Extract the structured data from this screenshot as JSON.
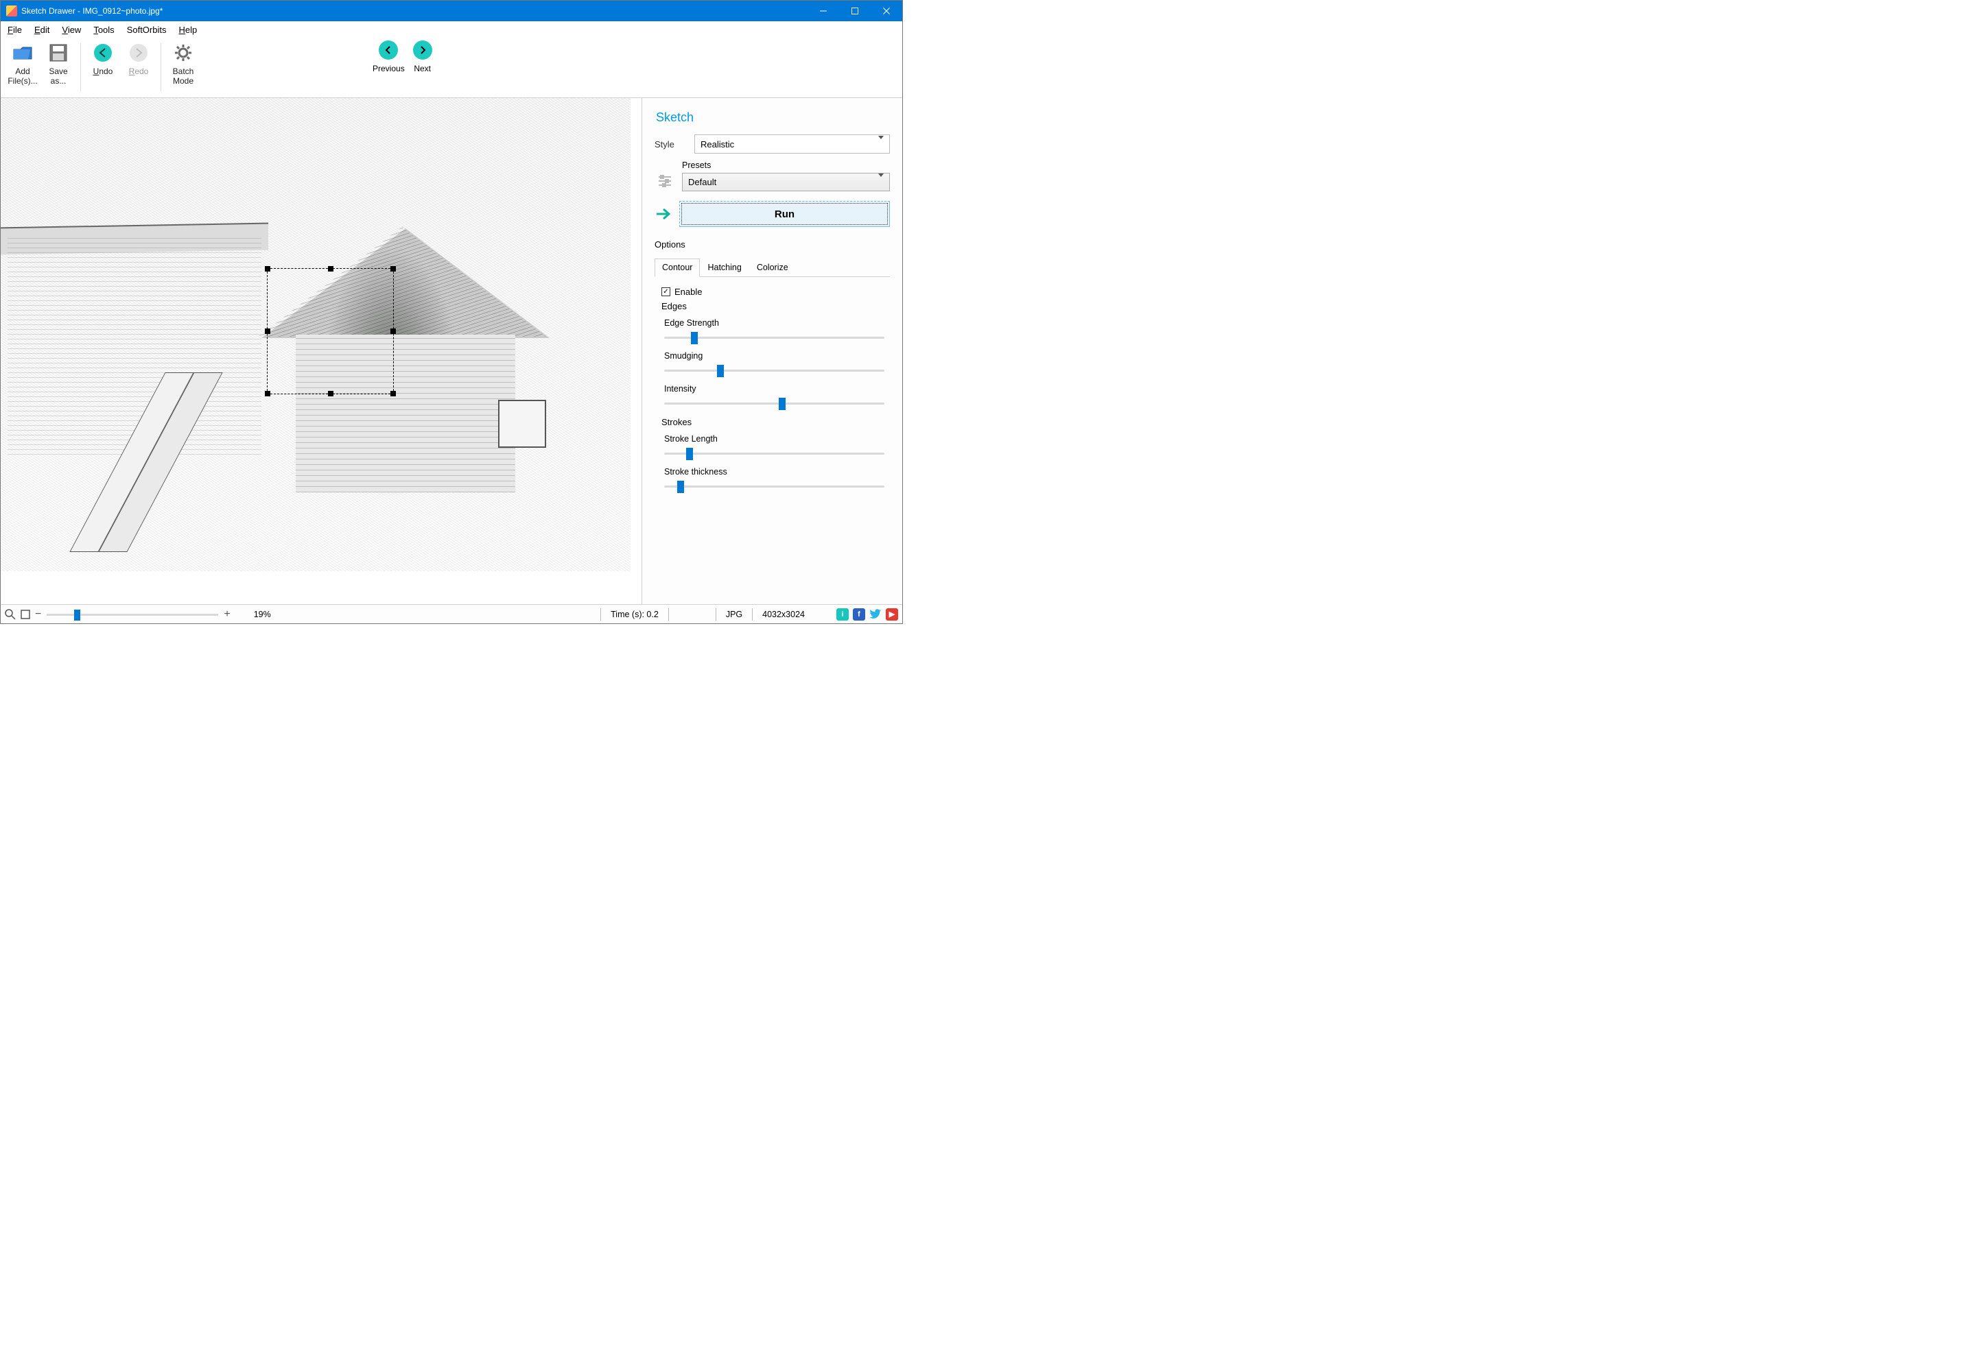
{
  "titlebar": {
    "title": "Sketch Drawer - IMG_0912~photo.jpg*"
  },
  "menu": {
    "file": "File",
    "edit": "Edit",
    "view": "View",
    "tools": "Tools",
    "softorbits": "SoftOrbits",
    "help": "Help"
  },
  "toolbar": {
    "add_files": "Add File(s)...",
    "save_as": "Save as...",
    "undo": "Undo",
    "redo": "Redo",
    "batch_mode": "Batch Mode",
    "previous": "Previous",
    "next": "Next"
  },
  "panel": {
    "title": "Sketch",
    "style_label": "Style",
    "style_value": "Realistic",
    "presets_label": "Presets",
    "presets_value": "Default",
    "run": "Run",
    "options": "Options",
    "tabs": {
      "contour": "Contour",
      "hatching": "Hatching",
      "colorize": "Colorize"
    },
    "enable": "Enable",
    "edges": "Edges",
    "sliders": {
      "edge_strength": {
        "label": "Edge Strength",
        "pct": 12
      },
      "smudging": {
        "label": "Smudging",
        "pct": 24
      },
      "intensity": {
        "label": "Intensity",
        "pct": 52
      },
      "strokes_header": "Strokes",
      "stroke_length": {
        "label": "Stroke Length",
        "pct": 10
      },
      "stroke_thickness": {
        "label": "Stroke thickness",
        "pct": 6
      }
    }
  },
  "status": {
    "zoom_pct": "19%",
    "zoom_slider_pct": 16,
    "time": "Time (s): 0.2",
    "format": "JPG",
    "dimensions": "4032x3024"
  }
}
